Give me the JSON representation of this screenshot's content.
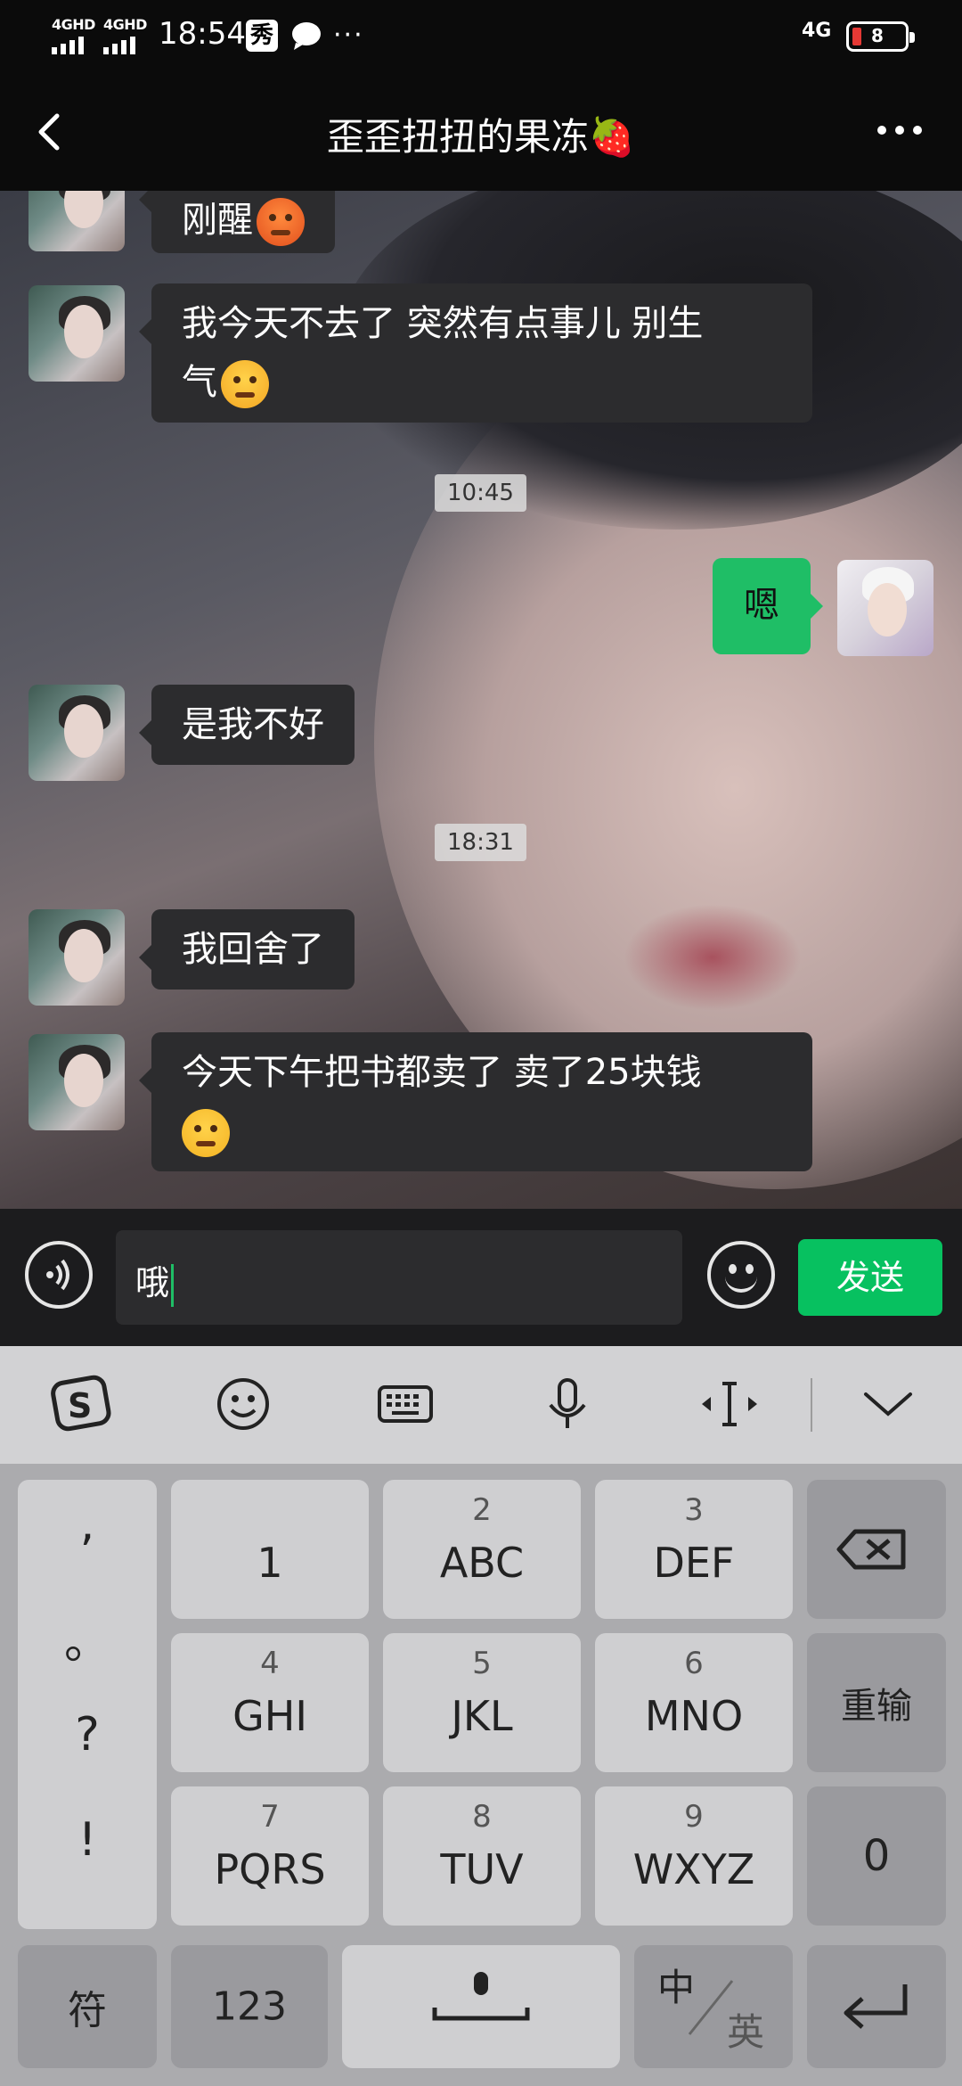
{
  "status_bar": {
    "sim1": "4GHD",
    "sim2": "4GHD",
    "time": "18:54",
    "app_badge": "秀",
    "more": "···",
    "network": "4G",
    "battery": "8"
  },
  "header": {
    "title": "歪歪扭扭的果冻🍓"
  },
  "messages": [
    {
      "sender": "other",
      "text": "刚醒",
      "emoji": "hot-face"
    },
    {
      "sender": "other",
      "line1": "我今天不去了 突然有点事儿 别生",
      "line2": "气",
      "emoji": "angry-face"
    },
    {
      "type": "time",
      "text": "10:45"
    },
    {
      "sender": "me",
      "text": "嗯"
    },
    {
      "sender": "other",
      "text": "是我不好"
    },
    {
      "type": "time",
      "text": "18:31"
    },
    {
      "sender": "other",
      "text": "我回舍了"
    },
    {
      "sender": "other",
      "line1": "今天下午把书都卖了 卖了25块钱",
      "emoji": "crying-laughing-face"
    }
  ],
  "composer": {
    "input_value": "哦",
    "send_label": "发送"
  },
  "keyboard": {
    "punctuation": [
      ",",
      "。",
      "?",
      "!"
    ],
    "rows": [
      [
        {
          "sub": "",
          "main": "1"
        },
        {
          "sub": "2",
          "main": "ABC"
        },
        {
          "sub": "3",
          "main": "DEF"
        }
      ],
      [
        {
          "sub": "4",
          "main": "GHI"
        },
        {
          "sub": "5",
          "main": "JKL"
        },
        {
          "sub": "6",
          "main": "MNO"
        }
      ],
      [
        {
          "sub": "7",
          "main": "PQRS"
        },
        {
          "sub": "8",
          "main": "TUV"
        },
        {
          "sub": "9",
          "main": "WXYZ"
        }
      ]
    ],
    "reenter": "重输",
    "zero": "0",
    "symbols": "符",
    "numbers": "123",
    "zh": "中",
    "en": "英"
  }
}
